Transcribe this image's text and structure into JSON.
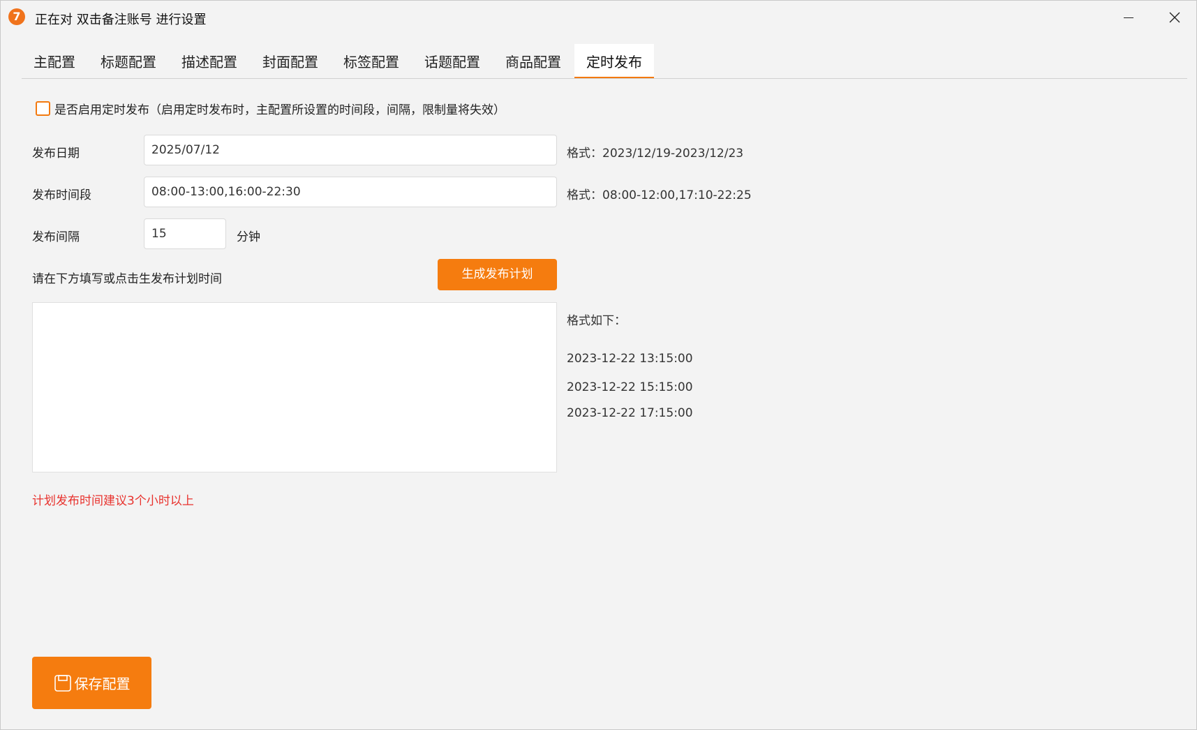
{
  "window": {
    "title": "正在对 双击备注账号 进行设置",
    "app_icon_text": "7"
  },
  "tabs": [
    {
      "label": "主配置"
    },
    {
      "label": "标题配置"
    },
    {
      "label": "描述配置"
    },
    {
      "label": "封面配置"
    },
    {
      "label": "标签配置"
    },
    {
      "label": "话题配置"
    },
    {
      "label": "商品配置"
    },
    {
      "label": "定时发布",
      "active": true
    }
  ],
  "schedule": {
    "enable_label": "是否启用定时发布（启用定时发布时，主配置所设置的时间段，间隔，限制量将失效）",
    "enabled": false,
    "date_label": "发布日期",
    "date_value": "2025/07/12",
    "date_hint": "格式：2023/12/19-2023/12/23",
    "time_label": "发布时间段",
    "time_value": "08:00-13:00,16:00-22:30",
    "time_hint": "格式：08:00-12:00,17:10-22:25",
    "interval_label": "发布间隔",
    "interval_value": "15",
    "interval_unit": "分钟",
    "plan_prompt": "请在下方填写或点击生发布计划时间",
    "generate_button": "生成发布计划",
    "plan_text": "",
    "format_title": "格式如下：",
    "format_examples": [
      "2023-12-22 13:15:00",
      "2023-12-22 15:15:00",
      "2023-12-22 17:15:00"
    ],
    "warning": "计划发布时间建议3个小时以上"
  },
  "save_button": "保存配置",
  "colors": {
    "accent": "#f57c0f",
    "warning": "#e8322d"
  }
}
